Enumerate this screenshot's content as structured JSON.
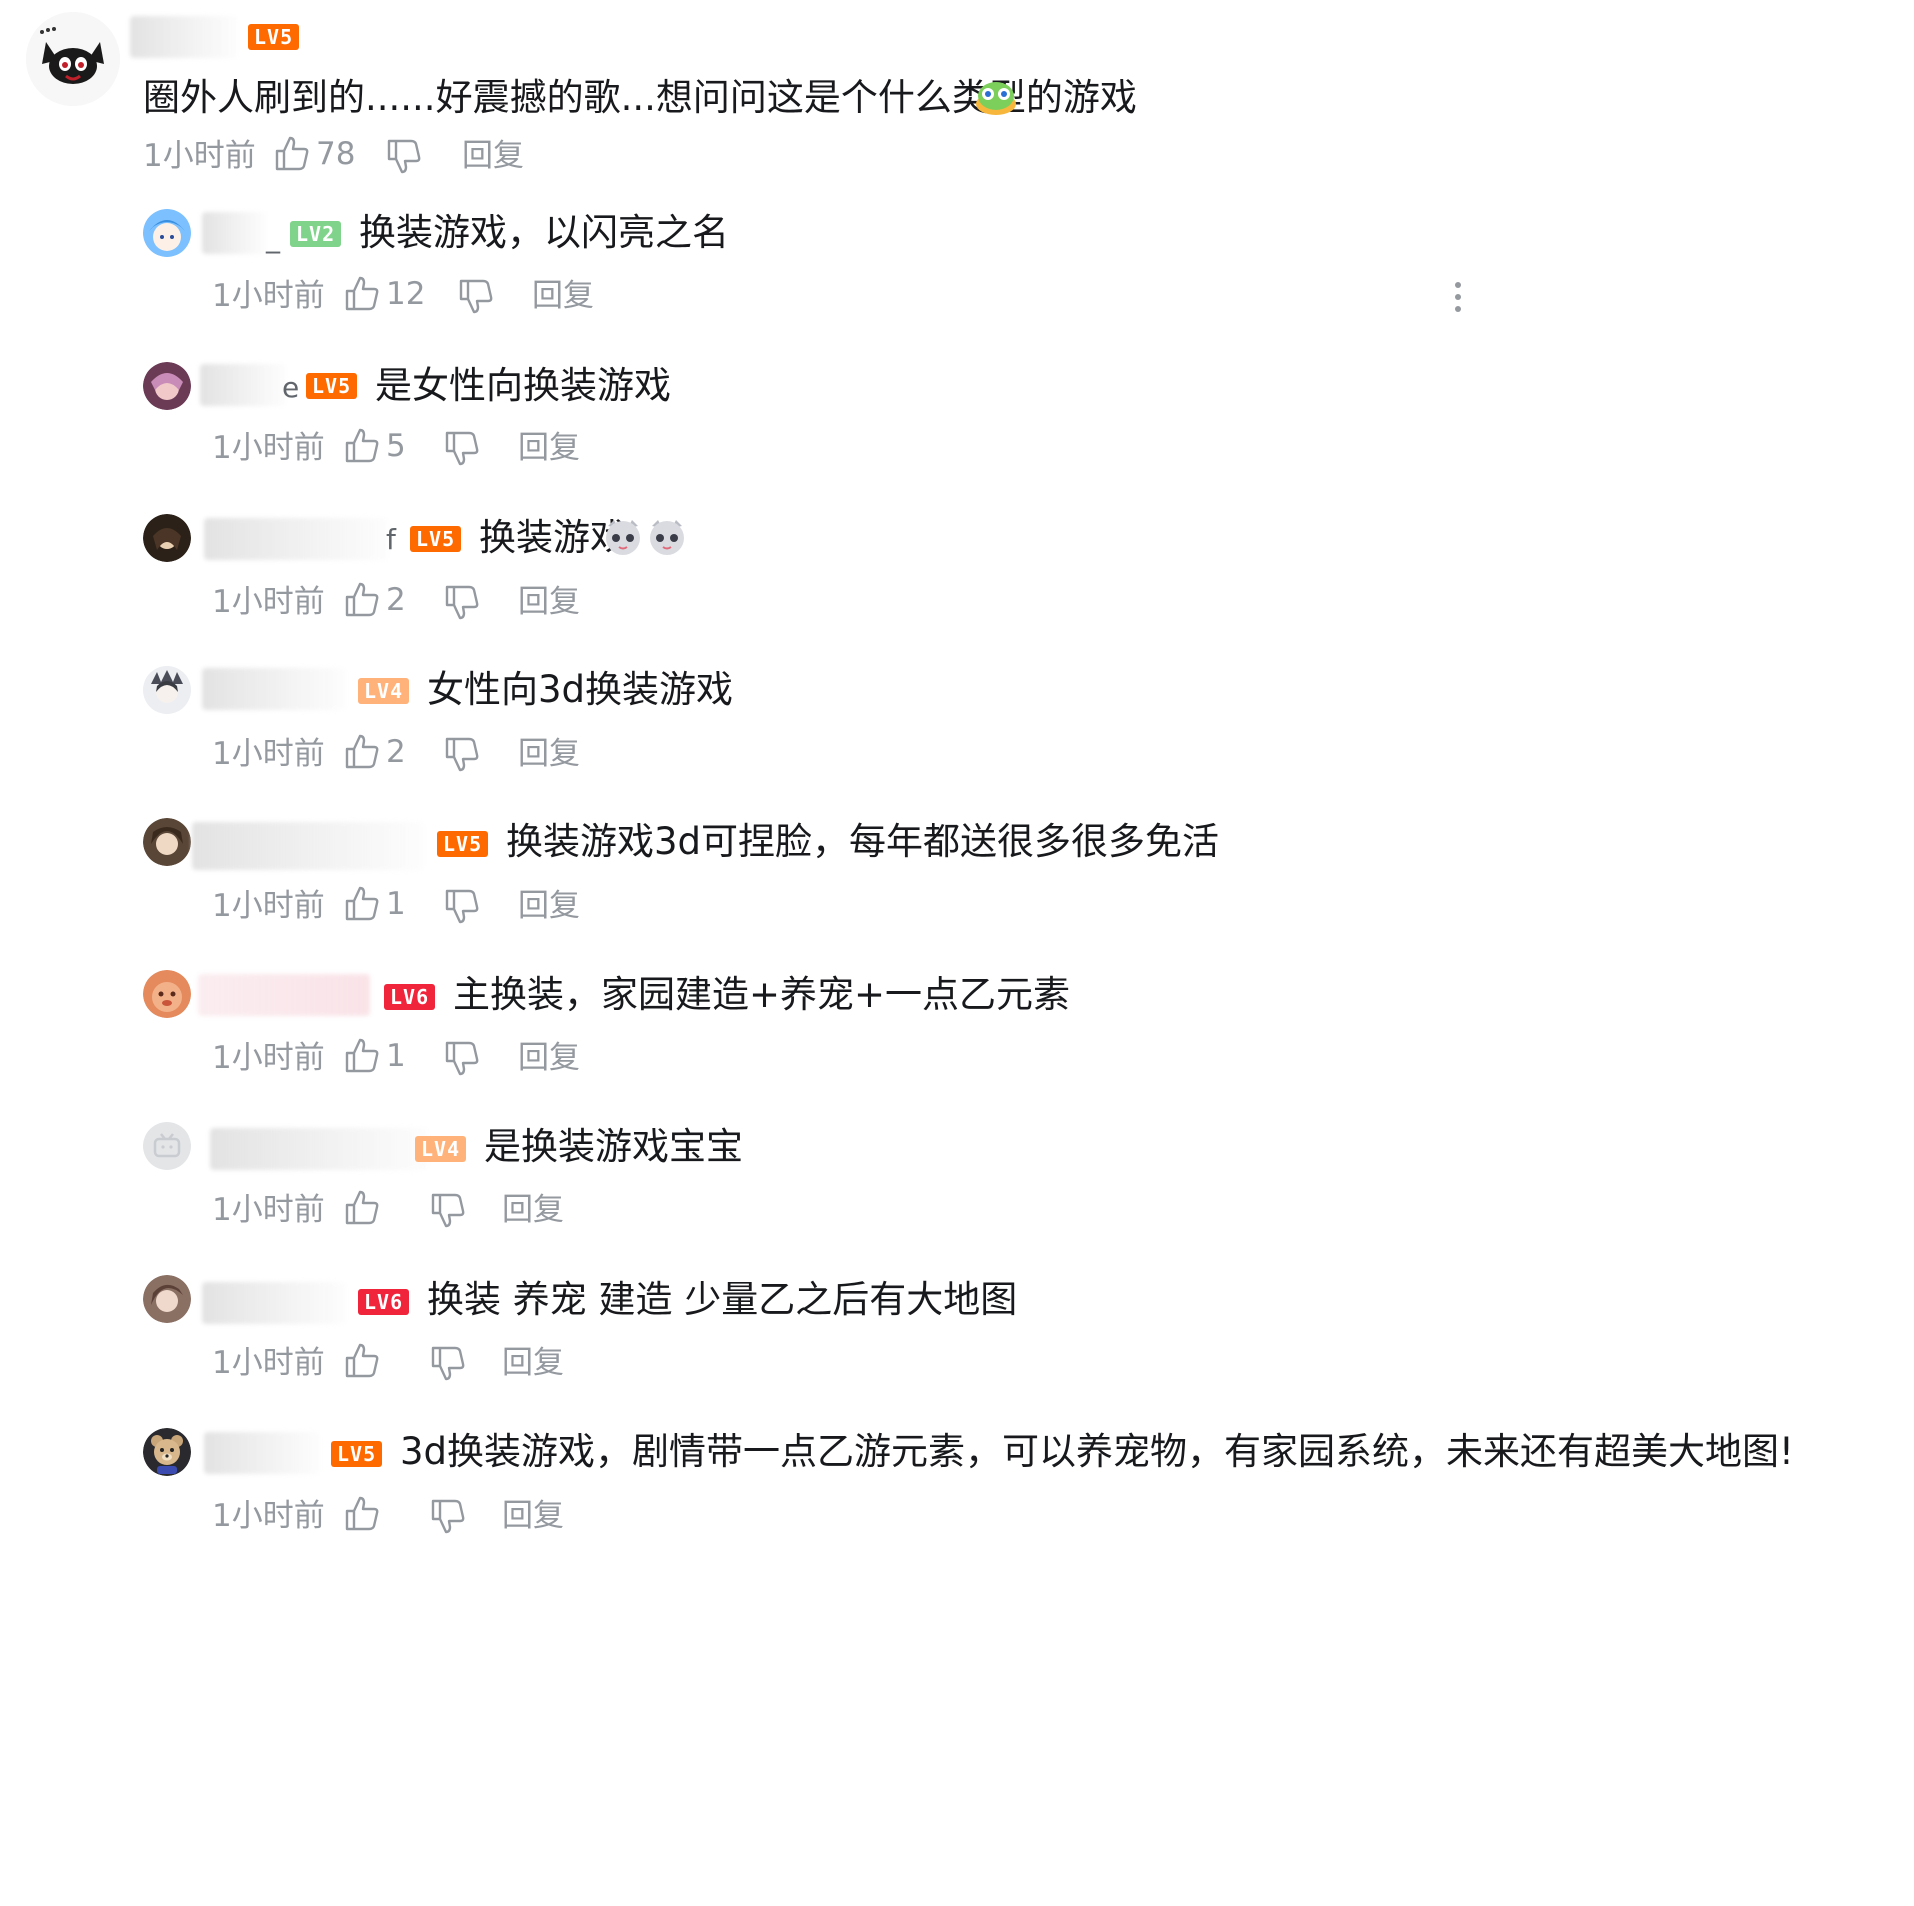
{
  "top_comment": {
    "level": "LV5",
    "text": "圈外人刷到的......好震撼的歌...想问问这是个什么类型的游戏",
    "time": "1小时前",
    "likes": "78",
    "reply_label": "回复",
    "avatar_icon": "cartoon-cat-avatar-icon",
    "emoji_icon": "green-blob-emoji-icon"
  },
  "replies": [
    {
      "name_suffix": "_",
      "level": "LV2",
      "text": "换装游戏，以闪亮之名",
      "time": "1小时前",
      "likes": "12",
      "reply_label": "回复"
    },
    {
      "name_suffix": "e",
      "level": "LV5",
      "text": "是女性向换装游戏",
      "time": "1小时前",
      "likes": "5",
      "reply_label": "回复"
    },
    {
      "name_suffix": "f",
      "level": "LV5",
      "text": "换装游戏",
      "time": "1小时前",
      "likes": "2",
      "reply_label": "回复"
    },
    {
      "name_suffix": "",
      "level": "LV4",
      "text": "女性向3d换装游戏",
      "time": "1小时前",
      "likes": "2",
      "reply_label": "回复"
    },
    {
      "name_suffix": "",
      "level": "LV5",
      "text": "换装游戏3d可捏脸，每年都送很多很多免活",
      "time": "1小时前",
      "likes": "1",
      "reply_label": "回复"
    },
    {
      "name_suffix": "",
      "level": "LV6",
      "text": "主换装，家园建造+养宠+一点乙元素",
      "time": "1小时前",
      "likes": "1",
      "reply_label": "回复"
    },
    {
      "name_suffix": "",
      "level": "LV4",
      "text": "是换装游戏宝宝",
      "time": "1小时前",
      "likes": "",
      "reply_label": "回复"
    },
    {
      "name_suffix": "",
      "level": "LV6",
      "text": "换装 养宠 建造 少量乙之后有大地图",
      "time": "1小时前",
      "likes": "",
      "reply_label": "回复"
    },
    {
      "name_suffix": "",
      "level": "LV5",
      "text": "3d换装游戏，剧情带一点乙游元素，可以养宠物，有家园系统，未来还有超美大地图!",
      "time": "1小时前",
      "likes": "",
      "reply_label": "回复"
    }
  ],
  "icons": {
    "like": "thumbs-up-icon",
    "dislike": "thumbs-down-icon",
    "more": "more-vertical-icon",
    "reply_emoji": "grey-cat-emoji-icon"
  },
  "colors": {
    "text": "#18191c",
    "meta": "#9499a0",
    "lv5": "#ff6a00",
    "lv6": "#f0243a",
    "lv4": "#ffb27a",
    "lv2": "#7fd38a"
  }
}
